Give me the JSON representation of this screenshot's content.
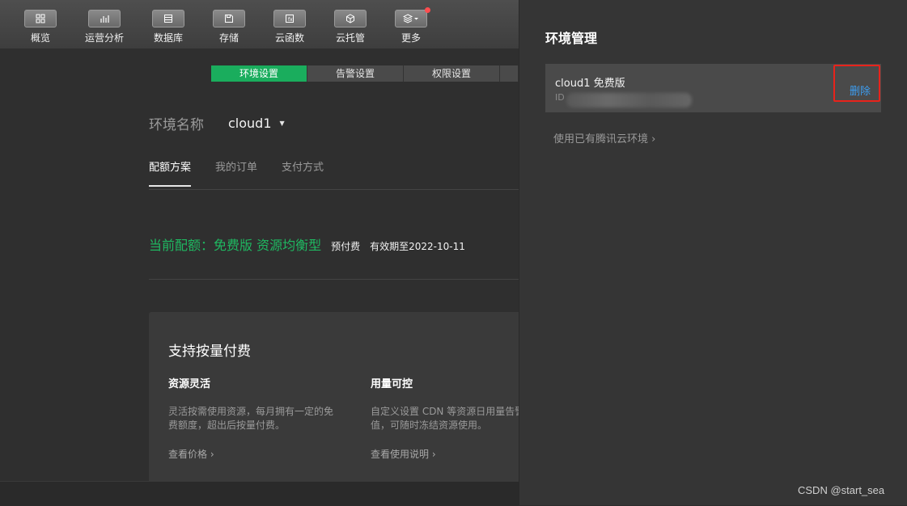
{
  "toolbar": {
    "items": [
      {
        "label": "概览",
        "icon": "grid-icon"
      },
      {
        "label": "运营分析",
        "icon": "bar-chart-icon"
      },
      {
        "label": "数据库",
        "icon": "database-icon"
      },
      {
        "label": "存储",
        "icon": "save-icon"
      },
      {
        "label": "云函数",
        "icon": "function-icon"
      },
      {
        "label": "云托管",
        "icon": "cube-icon"
      },
      {
        "label": "更多",
        "icon": "layers-icon"
      }
    ]
  },
  "tabs": [
    "环境设置",
    "告警设置",
    "权限设置"
  ],
  "env": {
    "label": "环境名称",
    "value": "cloud1"
  },
  "subtabs": [
    "配额方案",
    "我的订单",
    "支付方式"
  ],
  "quota": {
    "main": "当前配额：免费版 资源均衡型",
    "prepay": "预付费",
    "valid": "有效期至2022-10-11"
  },
  "card": {
    "title": "支持按量付费",
    "features": [
      {
        "title": "资源灵活",
        "desc": "灵活按需使用资源，每月拥有一定的免费额度，超出后按量付费。",
        "link": "查看价格 ›"
      },
      {
        "title": "用量可控",
        "desc": "自定义设置 CDN 等资源日用量告警阈值，可随时冻结资源使用。",
        "link": "查看使用说明 ›"
      }
    ]
  },
  "panel": {
    "title": "环境管理",
    "env_name": "cloud1 免费版",
    "id_label": "ID",
    "delete": "删除",
    "link": "使用已有腾讯云环境 ›"
  },
  "watermark": "CSDN @start_sea",
  "colors": {
    "accent": "#1aad5d",
    "link": "#3d9df0",
    "highlight": "#e8231b"
  }
}
